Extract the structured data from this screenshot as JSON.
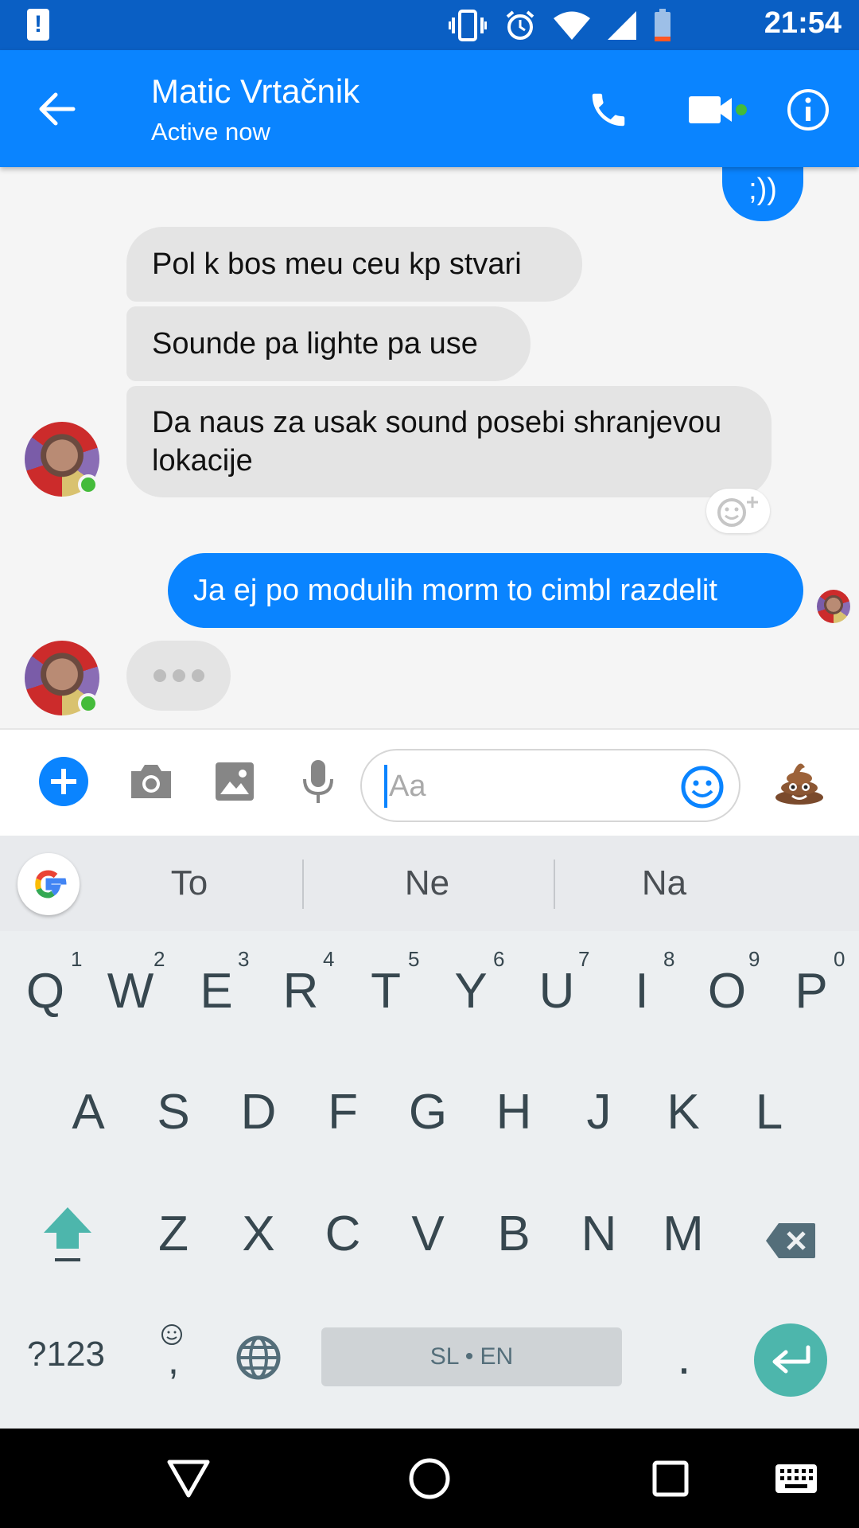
{
  "status_bar": {
    "time": "21:54"
  },
  "header": {
    "contact_name": "Matic Vrtačnik",
    "contact_status": "Active now"
  },
  "messages": [
    {
      "from": "me",
      "text": ";))"
    },
    {
      "from": "them",
      "text": "Pol k bos meu ceu kp stvari"
    },
    {
      "from": "them",
      "text": "Sounde pa lighte pa use"
    },
    {
      "from": "them",
      "text": "Da naus za usak sound posebi shranjevou lokacije"
    },
    {
      "from": "me",
      "text": "Ja ej po modulih morm to cimbl razdelit"
    }
  ],
  "composer": {
    "placeholder": "Aa"
  },
  "keyboard": {
    "suggestions": [
      "To",
      "Ne",
      "Na"
    ],
    "row1": [
      "Q",
      "W",
      "E",
      "R",
      "T",
      "Y",
      "U",
      "I",
      "O",
      "P"
    ],
    "row1_numbers": [
      "1",
      "2",
      "3",
      "4",
      "5",
      "6",
      "7",
      "8",
      "9",
      "0"
    ],
    "row2": [
      "A",
      "S",
      "D",
      "F",
      "G",
      "H",
      "J",
      "K",
      "L"
    ],
    "row3": [
      "Z",
      "X",
      "C",
      "V",
      "B",
      "N",
      "M"
    ],
    "symbols_label": "?123",
    "comma": ",",
    "period": ".",
    "space_label": "SL • EN"
  },
  "colors": {
    "accent": "#0a84ff",
    "status_bar": "#0a5fc4",
    "received_bubble": "#e4e4e4",
    "online": "#44bb3a",
    "enter_key": "#4db6ac"
  }
}
